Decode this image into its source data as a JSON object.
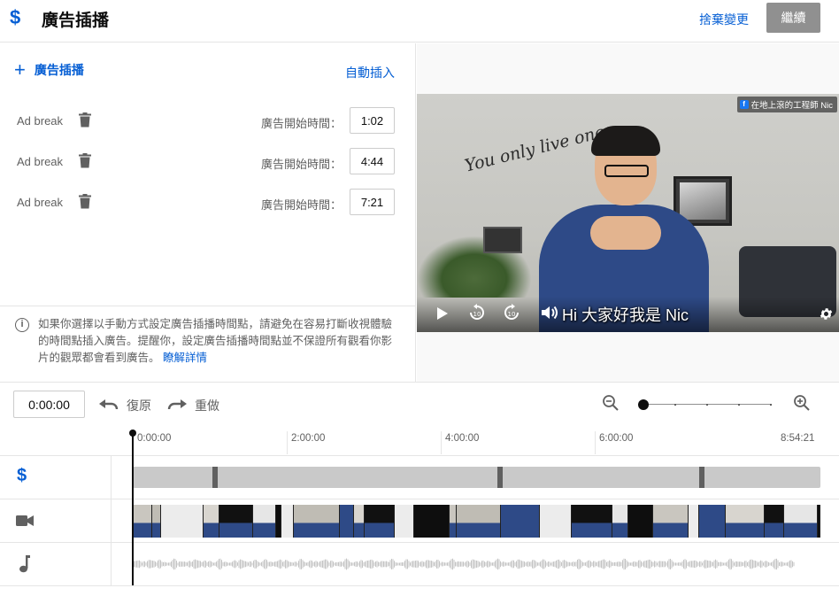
{
  "header": {
    "icon": "dollar-icon",
    "title": "廣告插播",
    "discard_label": "捨棄變更",
    "continue_label": "繼續"
  },
  "left_panel": {
    "add_label": "廣告插播",
    "auto_insert_label": "自動插入",
    "breaks": [
      {
        "name": "Ad break",
        "start_label": "廣告開始時間：",
        "time": "1:02"
      },
      {
        "name": "Ad break",
        "start_label": "廣告開始時間：",
        "time": "4:44"
      },
      {
        "name": "Ad break",
        "start_label": "廣告開始時間：",
        "time": "7:21"
      }
    ],
    "info_text": "如果你選擇以手動方式設定廣告插播時間點，請避免在容易打斷收視體驗的時間點插入廣告。提醒你，設定廣告插播時間點並不保證所有觀看你影片的觀眾都會看到廣告。",
    "learn_more": "瞭解詳情"
  },
  "video": {
    "channel_tag": "在地上滾的工程師 Nic",
    "slogan": "You only live once",
    "subtitle": "Hi 大家好我是 Nic",
    "controls": [
      "play-icon",
      "rewind-10-icon",
      "forward-10-icon",
      "volume-icon",
      "settings-icon"
    ]
  },
  "timeline": {
    "current_time": "0:00:00",
    "undo_label": "復原",
    "redo_label": "重做",
    "ruler_ticks": [
      "0:00:00",
      "2:00:00",
      "4:00:00",
      "6:00:00",
      "8:54:21"
    ],
    "track_icons": [
      "dollar-icon",
      "video-camera-icon",
      "music-note-icon"
    ]
  },
  "colors": {
    "accent": "#065fd4",
    "continue_disabled": "#909090",
    "ad_track": "#c9c9c9",
    "ad_marker": "#606060"
  }
}
